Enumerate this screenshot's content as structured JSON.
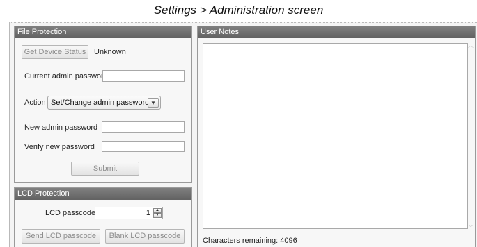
{
  "caption": "Settings > Administration screen",
  "file_protection": {
    "title": "File Protection",
    "get_status_label": "Get Device Status",
    "status_value": "Unknown",
    "current_pw_label": "Current admin password",
    "current_pw_value": "",
    "action_label": "Action",
    "action_selected": "Set/Change admin password",
    "new_pw_label": "New admin password",
    "new_pw_value": "",
    "verify_pw_label": "Verify new password",
    "verify_pw_value": "",
    "submit_label": "Submit"
  },
  "lcd_protection": {
    "title": "LCD Protection",
    "passcode_label": "LCD passcode",
    "passcode_value": "1",
    "send_label": "Send LCD passcode",
    "blank_label": "Blank LCD passcode"
  },
  "user_notes": {
    "title": "User Notes",
    "text": "",
    "chars_remaining_label": "Characters remaining:",
    "chars_remaining_value": "4096"
  },
  "icons": {
    "dropdown": "chevron-down-icon",
    "spin_up": "triangle-up-icon",
    "spin_down": "triangle-down-icon"
  }
}
